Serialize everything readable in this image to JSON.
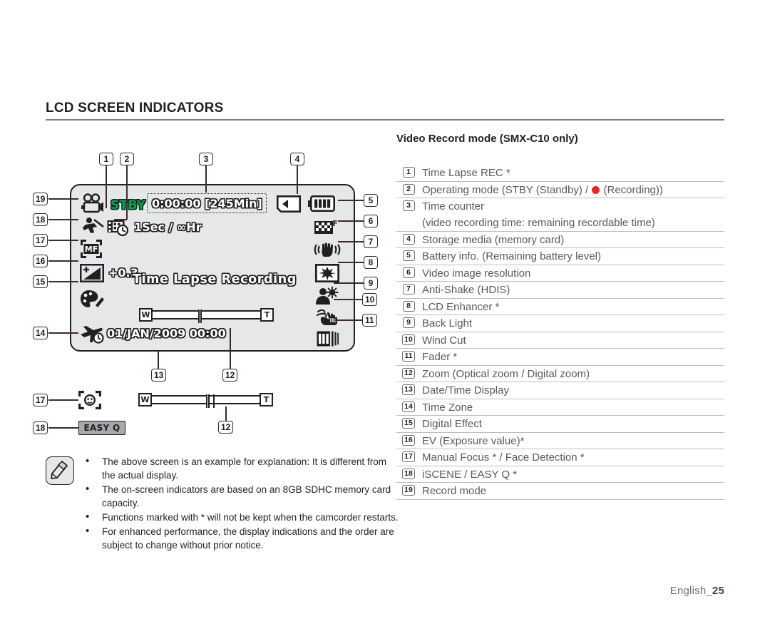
{
  "page": {
    "section_title": "LCD SCREEN INDICATORS",
    "footer_label": "English_",
    "footer_page": "25"
  },
  "right_panel": {
    "subhead": "Video Record mode (SMX-C10 only)",
    "items": [
      {
        "num": "1",
        "label": "Time Lapse REC *"
      },
      {
        "num": "2",
        "label_pre": "Operating mode (STBY (Standby) / ",
        "label_post": " (Recording))"
      },
      {
        "num": "3",
        "label": "Time counter",
        "sub": "(video recording time: remaining recordable time)"
      },
      {
        "num": "4",
        "label": "Storage media (memory card)"
      },
      {
        "num": "5",
        "label": "Battery info. (Remaining battery level)"
      },
      {
        "num": "6",
        "label": "Video image resolution"
      },
      {
        "num": "7",
        "label": "Anti-Shake (HDIS)"
      },
      {
        "num": "8",
        "label": "LCD Enhancer *"
      },
      {
        "num": "9",
        "label": "Back Light"
      },
      {
        "num": "10",
        "label": "Wind Cut"
      },
      {
        "num": "11",
        "label": "Fader *"
      },
      {
        "num": "12",
        "label": "Zoom (Optical zoom / Digital zoom)"
      },
      {
        "num": "13",
        "label": "Date/Time Display"
      },
      {
        "num": "14",
        "label": "Time Zone"
      },
      {
        "num": "15",
        "label": "Digital Effect"
      },
      {
        "num": "16",
        "label": "EV (Exposure value)*"
      },
      {
        "num": "17",
        "label": "Manual Focus * / Face Detection *"
      },
      {
        "num": "18",
        "label": "iSCENE / EASY Q *"
      },
      {
        "num": "19",
        "label": "Record mode"
      }
    ],
    "recording_dot_color": "#e8252a"
  },
  "lcd": {
    "background": "#e6e7e8",
    "stby_text": "STBY",
    "stby_color": "#00a650",
    "time_counter": "0:00:00 [245Min]",
    "time_lapse_interval": "1Sec / ∞Hr",
    "manual_focus_label": "MF",
    "ev_value": "+0.3",
    "center_message": "Time Lapse Recording",
    "datetime": "01/JAN/2009 00:00",
    "zoom_wide_label": "W",
    "zoom_tele_label": "T"
  },
  "callouts": {
    "top": [
      "1",
      "2",
      "3",
      "4"
    ],
    "left": [
      "19",
      "18",
      "17",
      "16",
      "15",
      "14"
    ],
    "right": [
      "5",
      "6",
      "7",
      "8",
      "9",
      "10",
      "11"
    ],
    "bottom": [
      "13",
      "12"
    ],
    "extra_left": [
      "17",
      "18"
    ],
    "extra_bottom": [
      "12"
    ]
  },
  "extra_row": {
    "easy_q_label": "EASY Q",
    "zoom_wide_label": "W",
    "zoom_tele_label": "T"
  },
  "notes": [
    "The above screen is an example for explanation: It is different from the actual display.",
    "The on-screen indicators are based on an 8GB SDHC memory card capacity.",
    "Functions marked with * will not be kept when the camcorder restarts.",
    "For enhanced performance, the display indications and the order are subject to change without prior notice."
  ]
}
